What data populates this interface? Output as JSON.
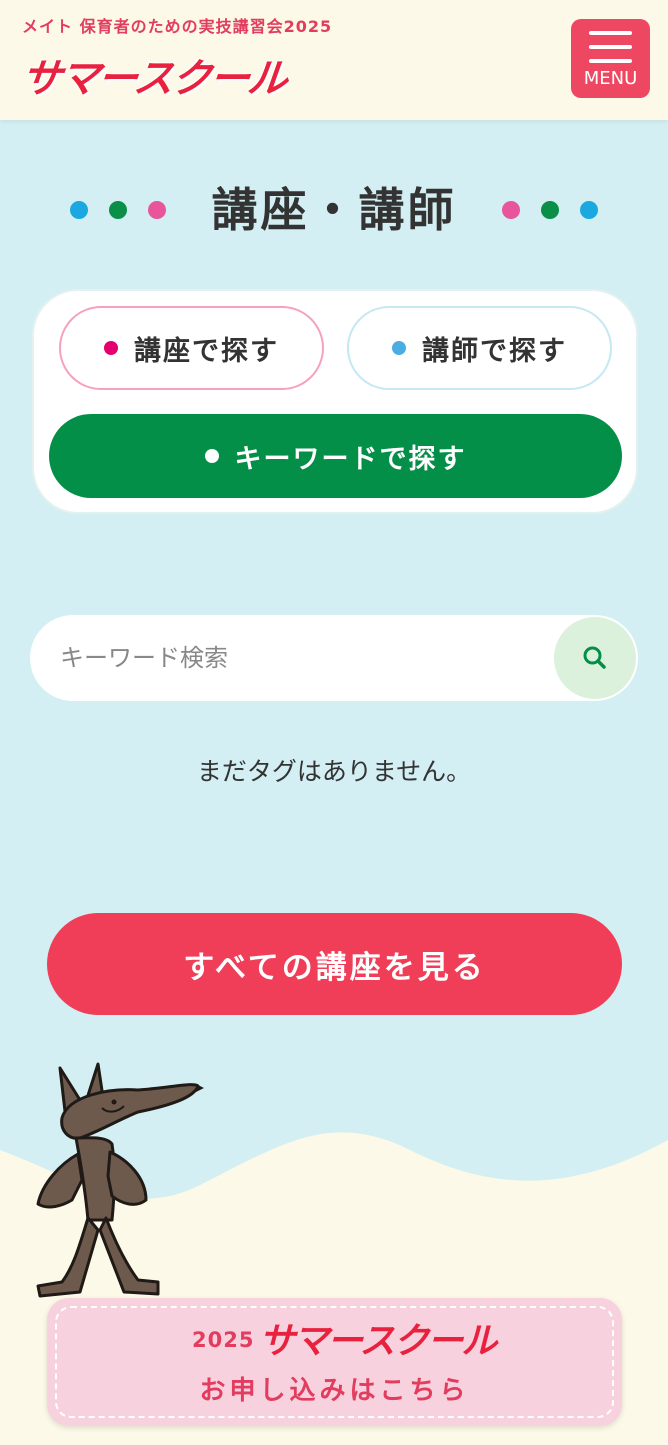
{
  "header": {
    "tagline": "メイト 保育者のための実技講習会2025",
    "logo_text": "サマースクール",
    "menu_label": "MENU"
  },
  "section": {
    "title": "講座・講師"
  },
  "tabs": {
    "lecture_label": "講座で探す",
    "teacher_label": "講師で探す",
    "keyword_label": "キーワードで探す"
  },
  "search": {
    "placeholder": "キーワード検索",
    "value": ""
  },
  "tags": {
    "empty_message": "まだタグはありません。"
  },
  "cta": {
    "all_lectures_label": "すべての講座を見る"
  },
  "apply_banner": {
    "year": "2025",
    "brand": "サマースクール",
    "label": "お申し込みはこちら"
  },
  "colors": {
    "accent_red": "#f03e58",
    "keyword_green": "#038f48",
    "background": "#d3eff3",
    "cream": "#fcf9e8",
    "dot_blue": "#1ba8e0",
    "dot_green": "#0a8f49",
    "dot_pink": "#e8559a"
  },
  "icons": {
    "menu": "hamburger-icon",
    "search": "search-icon",
    "mascot": "wolf-mascot"
  }
}
